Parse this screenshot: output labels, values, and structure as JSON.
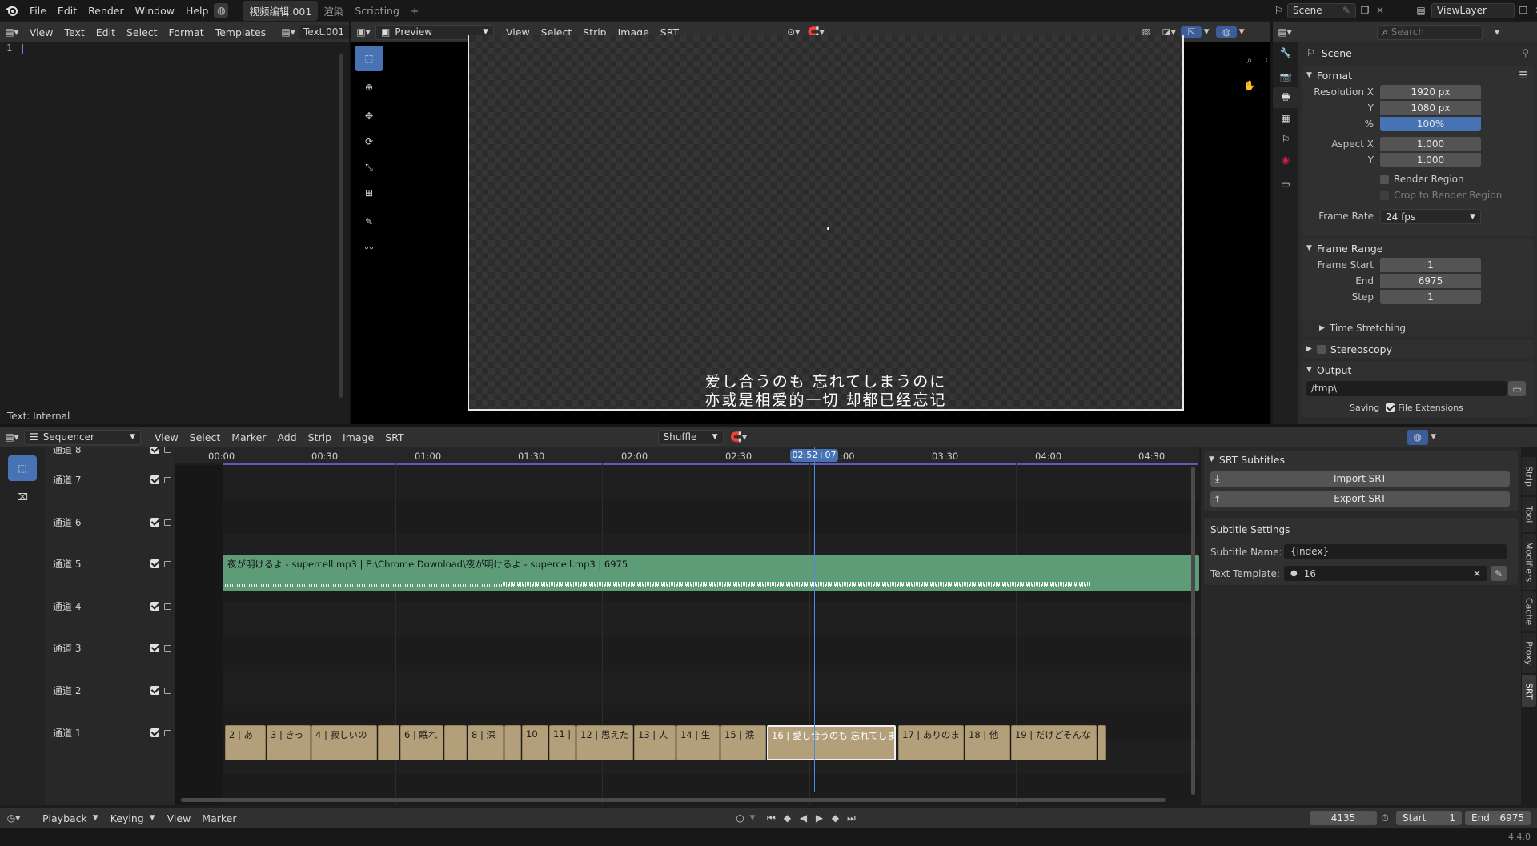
{
  "topbar": {
    "menus": [
      "File",
      "Edit",
      "Render",
      "Window",
      "Help"
    ],
    "workspaces": [
      "视频编辑.001",
      "渲染",
      "Scripting"
    ],
    "add_workspace": "+",
    "scene_name": "Scene",
    "view_layer": "ViewLayer"
  },
  "text_editor": {
    "menus": [
      "View",
      "Text",
      "Edit",
      "Select",
      "Format",
      "Templates"
    ],
    "text_name": "Text.001",
    "line_number": "1",
    "status": "Text: Internal"
  },
  "preview": {
    "mode": "Preview",
    "menus": [
      "View",
      "Select",
      "Strip",
      "Image",
      "SRT"
    ],
    "subtitle_line1": "爱し合うのも 忘れてしまうのに",
    "subtitle_line2": "亦或是相爱的一切 却都已经忘记"
  },
  "properties": {
    "search_placeholder": "Search",
    "scene_label": "Scene",
    "format_header": "Format",
    "resolution_x_label": "Resolution X",
    "resolution_x": "1920 px",
    "resolution_y_label": "Y",
    "resolution_y": "1080 px",
    "resolution_pct_label": "%",
    "resolution_pct": "100%",
    "aspect_x_label": "Aspect X",
    "aspect_x": "1.000",
    "aspect_y_label": "Y",
    "aspect_y": "1.000",
    "render_region": "Render Region",
    "crop_region": "Crop to Render Region",
    "frame_rate_label": "Frame Rate",
    "frame_rate": "24 fps",
    "frame_range_header": "Frame Range",
    "frame_start_label": "Frame Start",
    "frame_start": "1",
    "end_label": "End",
    "end": "6975",
    "step_label": "Step",
    "step": "1",
    "time_stretching": "Time Stretching",
    "stereoscopy": "Stereoscopy",
    "output_header": "Output",
    "output_path": "/tmp\\",
    "saving_label": "Saving",
    "file_extensions": "File Extensions"
  },
  "sequencer": {
    "mode": "Sequencer",
    "menus": [
      "View",
      "Select",
      "Marker",
      "Add",
      "Strip",
      "Image",
      "SRT"
    ],
    "snap_mode": "Shuffle",
    "time_labels": [
      "00:00",
      "00:30",
      "01:00",
      "01:30",
      "02:00",
      "02:30",
      ":00",
      "03:30",
      "04:00",
      "04:30"
    ],
    "playhead": "02:52+07",
    "channels": [
      "通道 8",
      "通道 7",
      "通道 6",
      "通道 5",
      "通道 4",
      "通道 3",
      "通道 2",
      "通道 1"
    ],
    "audio_strip": "夜が明けるよ - supercell.mp3 | E:\\Chrome Download\\夜が明けるよ - supercell.mp3 | 6975",
    "text_strips": [
      "2 | あ",
      "3 | きっ",
      "4 | 寂しいの",
      "",
      "6 | 眠れ",
      "",
      "8 | 深",
      "",
      "10",
      "11 |",
      "12 | 思えた",
      "13 | 人",
      "14 | 生",
      "15 | 涙",
      "16 | 愛し合うのも 忘れてしま",
      "17 | ありのま",
      "18 | 他",
      "19 | だけどそんな",
      ""
    ]
  },
  "srt_panel": {
    "header": "SRT Subtitles",
    "import_label": "Import SRT",
    "export_label": "Export SRT",
    "settings_header": "Subtitle Settings",
    "name_label": "Subtitle Name:",
    "name_value": "{index}",
    "template_label": "Text Template:",
    "template_value": "16",
    "tabs": [
      "Strip",
      "Tool",
      "Modifiers",
      "Cache",
      "Proxy",
      "SRT"
    ]
  },
  "timeline": {
    "menus": [
      "Playback",
      "Keying",
      "View",
      "Marker"
    ],
    "current_frame": "4135",
    "start_label": "Start",
    "start": "1",
    "end_label": "End",
    "end": "6975",
    "version": "4.4.0"
  }
}
